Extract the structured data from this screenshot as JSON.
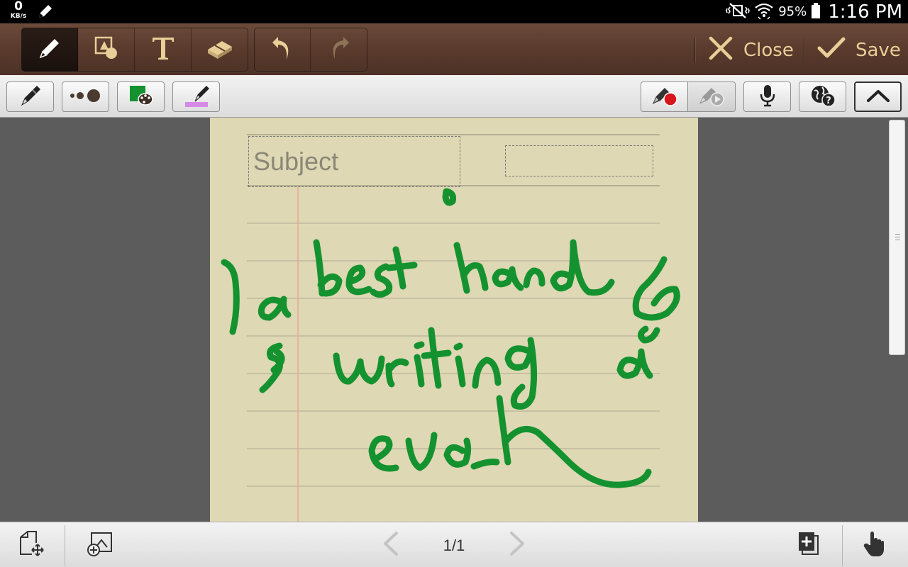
{
  "status_bar": {
    "net_speed_value": "0",
    "net_speed_unit": "KB/s",
    "battery_percent": "95%",
    "time": "1:16 PM"
  },
  "toolbar": {
    "close_label": "Close",
    "save_label": "Save"
  },
  "note": {
    "subject_placeholder": "Subject",
    "pen_color": "#14922f",
    "paper_color": "#ded8b4",
    "highlighter_color": "#d48ae6"
  },
  "bottom_bar": {
    "page_indicator": "1/1"
  }
}
